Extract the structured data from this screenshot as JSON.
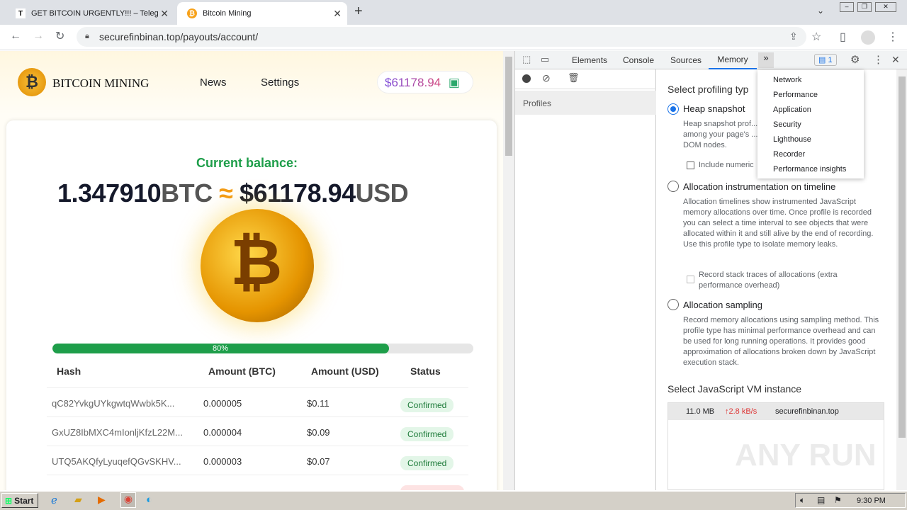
{
  "browser": {
    "tabs": [
      {
        "title": "GET BITCOIN URGENTLY!!! – Telegra",
        "favicon": "T"
      },
      {
        "title": "Bitcoin Mining",
        "favicon": "₿"
      }
    ],
    "url": "securefinbinan.top/payouts/account/"
  },
  "site": {
    "brand": "BITCOIN MINING",
    "nav": [
      "News",
      "Settings"
    ],
    "balance_chip": "$61178.94",
    "balance_label": "Current balance:",
    "btc_amount": "1.347910",
    "btc_unit": "BTC",
    "approx": "≈",
    "usd_amount": "$61178.94",
    "usd_unit": "USD",
    "progress_label": "80%",
    "progress": 0.8,
    "table": {
      "headers": [
        "Hash",
        "Amount (BTC)",
        "Amount (USD)",
        "Status"
      ],
      "rows": [
        {
          "hash": "qC82YvkgUYkgwtqWwbk5K...",
          "btc": "0.000005",
          "usd": "$0.11",
          "status": "Confirmed"
        },
        {
          "hash": "GxUZ8IbMXC4mIonljKfzL22M...",
          "btc": "0.000004",
          "usd": "$0.09",
          "status": "Confirmed"
        },
        {
          "hash": "UTQ5AKQfyLyuqefQGvSKHV...",
          "btc": "0.000003",
          "usd": "$0.07",
          "status": "Confirmed"
        }
      ]
    }
  },
  "devtools": {
    "tabs": [
      "Elements",
      "Console",
      "Sources",
      "Memory"
    ],
    "active_tab": "Memory",
    "issues_count": "1",
    "sidebar_header": "Profiles",
    "overflow_menu": [
      "Network",
      "Performance",
      "Application",
      "Security",
      "Lighthouse",
      "Recorder",
      "Performance insights"
    ],
    "profiling_title": "Select profiling typ",
    "options": [
      {
        "label": "Heap snapshot",
        "desc": "Heap snapshot prof... among your page's ... DOM nodes.",
        "checkbox": "Include numeric"
      },
      {
        "label": "Allocation instrumentation on timeline",
        "desc": "Allocation timelines show instrumented JavaScript memory allocations over time. Once profile is recorded you can select a time interval to see objects that were allocated within it and still alive by the end of recording. Use this profile type to isolate memory leaks.",
        "checkbox": "Record stack traces of allocations (extra performance overhead)"
      },
      {
        "label": "Allocation sampling",
        "desc": "Record memory allocations using sampling method. This profile type has minimal performance overhead and can be used for long running operations. It provides good approximation of allocations broken down by JavaScript execution stack."
      }
    ],
    "vm_title": "Select JavaScript VM instance",
    "vm": {
      "size": "11.0 MB",
      "rate": "↑2.8 kB/s",
      "host": "securefinbinan.top"
    }
  },
  "taskbar": {
    "start": "Start",
    "time": "9:30 PM"
  },
  "watermark": "ANY RUN"
}
